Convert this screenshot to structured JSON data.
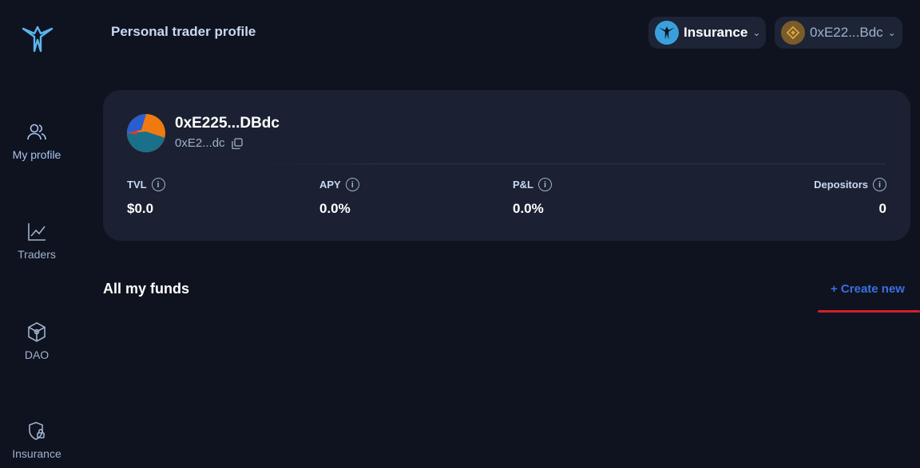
{
  "header": {
    "title": "Personal trader profile",
    "insurance_label": "Insurance",
    "wallet_label": "0xE22...Bdc"
  },
  "sidebar": {
    "items": [
      {
        "label": "My profile",
        "icon": "users-icon",
        "active": true
      },
      {
        "label": "Traders",
        "icon": "chart-line-icon",
        "active": false
      },
      {
        "label": "DAO",
        "icon": "cube-icon",
        "active": false
      },
      {
        "label": "Insurance",
        "icon": "shield-lock-icon",
        "active": false
      }
    ]
  },
  "profile": {
    "name": "0xE225...DBdc",
    "short_address": "0xE2...dc",
    "stats": [
      {
        "label": "TVL",
        "value": "$0.0"
      },
      {
        "label": "APY",
        "value": "0.0%"
      },
      {
        "label": "P&L",
        "value": "0.0%"
      },
      {
        "label": "Depositors",
        "value": "0"
      }
    ]
  },
  "funds": {
    "title": "All my funds",
    "create_label": "+ Create new"
  },
  "colors": {
    "background": "#0f1320",
    "card": "#1b2132",
    "accent_blue": "#3a6fe0",
    "annotation_red": "#d3202a"
  }
}
